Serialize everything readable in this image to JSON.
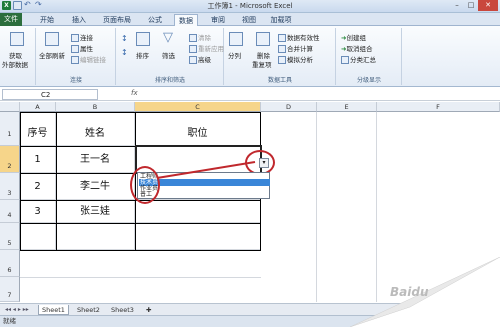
{
  "window": {
    "title": "工作簿1 - Microsoft Excel",
    "min": "–",
    "max": "□",
    "close": "✕"
  },
  "tabs": [
    "文件",
    "开始",
    "插入",
    "页面布局",
    "公式",
    "数据",
    "审阅",
    "视图",
    "加载项"
  ],
  "ribbon": {
    "g1": {
      "l1": "获取",
      "l2": "外部数据"
    },
    "g2": {
      "refresh": "全部刷新",
      "connect": "连接",
      "props": "属性",
      "editlinks": "编辑链接",
      "label": "连接"
    },
    "g3": {
      "sort": "排序",
      "filter": "筛选",
      "clear": "清除",
      "reapply": "重新应用",
      "advanced": "高级",
      "label": "排序和筛选"
    },
    "g4": {
      "split": "分列",
      "dedup1": "删除",
      "dedup2": "重复项",
      "validation": "数据有效性",
      "consolidate": "合并计算",
      "whatif": "模拟分析",
      "label": "数据工具"
    },
    "g5": {
      "group": "创建组",
      "ungroup": "取消组合",
      "subtotal": "分类汇总",
      "label": "分级显示"
    }
  },
  "formula": {
    "namebox": "C2",
    "fx": "fx"
  },
  "columns": [
    "A",
    "B",
    "C",
    "D",
    "E",
    "F"
  ],
  "rows": [
    "1",
    "2",
    "3",
    "4",
    "5",
    "6",
    "7"
  ],
  "table": {
    "header": [
      "序号",
      "姓名",
      "职位"
    ],
    "rows": [
      [
        "1",
        "王一名",
        ""
      ],
      [
        "2",
        "李二牛",
        ""
      ],
      [
        "3",
        "张三娃",
        ""
      ]
    ]
  },
  "dropdown": {
    "items": [
      "工程师",
      "技术员",
      "作业员",
      "普工"
    ],
    "highlighted": 1
  },
  "sheets": [
    "Sheet1",
    "Sheet2",
    "Sheet3"
  ],
  "status": "就绪",
  "watermark": "Baidu"
}
